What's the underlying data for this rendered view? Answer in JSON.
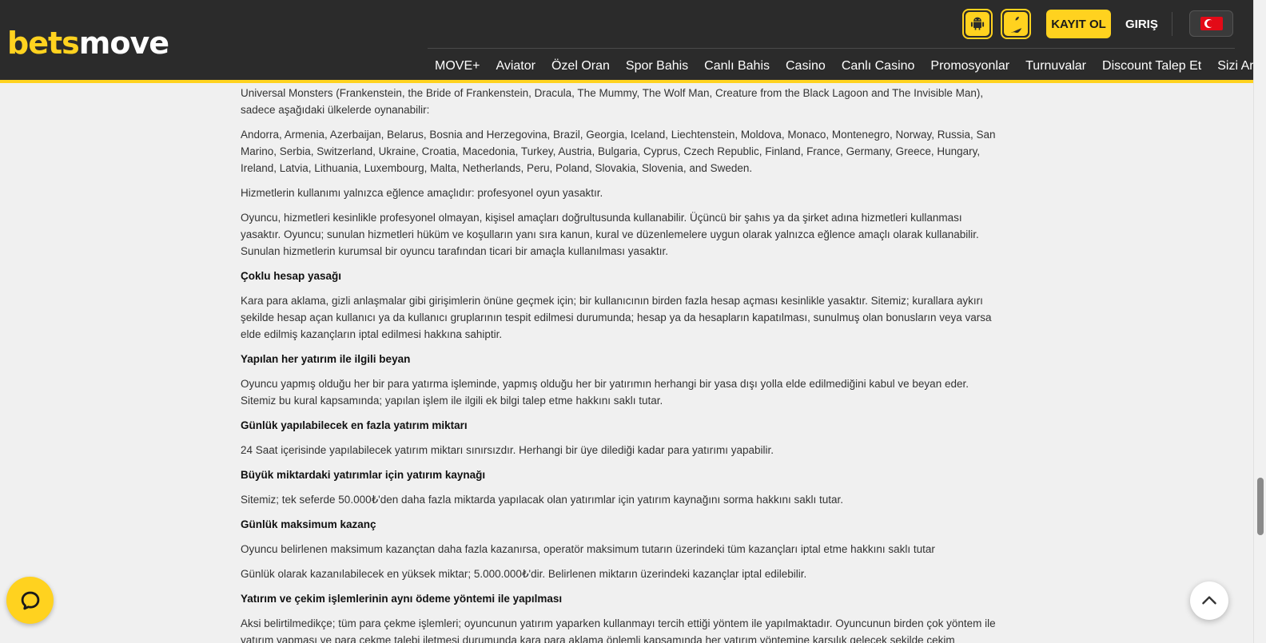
{
  "header": {
    "logo_part1": "bets",
    "logo_part2": "move",
    "register_label": "KAYIT OL",
    "login_label": "GIRIŞ",
    "nav": [
      "MOVE+",
      "Aviator",
      "Özel Oran",
      "Spor Bahis",
      "Canlı Bahis",
      "Casino",
      "Canlı Casino",
      "Promosyonlar",
      "Turnuvalar",
      "Discount Talep Et",
      "Sizi Arayalım"
    ]
  },
  "content": {
    "p1": "Universal Monsters (Frankenstein, the Bride of Frankenstein, Dracula, The Mummy, The Wolf Man, Creature from the Black Lagoon and The Invisible Man), sadece aşağıdaki ülkelerde oynanabilir:",
    "p2": "Andorra, Armenia, Azerbaijan, Belarus, Bosnia and Herzegovina, Brazil, Georgia, Iceland, Liechtenstein, Moldova, Monaco, Montenegro, Norway, Russia, San Marino, Serbia, Switzerland, Ukraine, Croatia, Macedonia, Turkey, Austria, Bulgaria, Cyprus, Czech Republic, Finland, France, Germany, Greece, Hungary, Ireland, Latvia, Lithuania, Luxembourg, Malta, Netherlands, Peru, Poland, Slovakia, Slovenia, and Sweden.",
    "p3": "Hizmetlerin kullanımı yalnızca eğlence amaçlıdır: profesyonel oyun yasaktır.",
    "p4": "Oyuncu, hizmetleri kesinlikle profesyonel olmayan, kişisel amaçları doğrultusunda kullanabilir. Üçüncü bir şahıs ya da şirket adına hizmetleri kullanması yasaktır. Oyuncu; sunulan hizmetleri hüküm ve koşulların yanı sıra kanun, kural ve düzenlemelere uygun olarak yalnızca eğlence amaçlı olarak kullanabilir. Sunulan hizmetlerin kurumsal bir oyuncu tarafından ticari bir amaçla kullanılması yasaktır.",
    "h1": "Çoklu hesap yasağı",
    "p5": "Kara para aklama, gizli anlaşmalar gibi girişimlerin önüne geçmek için; bir kullanıcının birden fazla hesap açması kesinlikle yasaktır. Sitemiz; kurallara aykırı şekilde hesap açan kullanıcı ya da kullanıcı gruplarının tespit edilmesi durumunda; hesap ya da hesapların kapatılması, sunulmuş olan bonusların veya varsa elde edilmiş kazançların iptal edilmesi hakkına sahiptir.",
    "h2": "Yapılan her yatırım ile ilgili beyan",
    "p6": "Oyuncu yapmış olduğu her bir para yatırma işleminde, yapmış olduğu her bir yatırımın herhangi bir yasa dışı yolla elde edilmediğini kabul ve beyan eder. Sitemiz bu kural kapsamında; yapılan işlem ile ilgili ek bilgi talep etme hakkını saklı tutar.",
    "h3": "Günlük yapılabilecek en fazla yatırım miktarı",
    "p7": "24 Saat içerisinde yapılabilecek yatırım miktarı sınırsızdır. Herhangi bir üye dilediği kadar para yatırımı yapabilir.",
    "h4": "Büyük miktardaki yatırımlar için yatırım kaynağı",
    "p8": "Sitemiz; tek seferde 50.000₺'den daha fazla miktarda yapılacak olan yatırımlar için yatırım kaynağını sorma hakkını saklı tutar.",
    "h5": "Günlük maksimum kazanç",
    "p9": "Oyuncu belirlenen maksimum kazançtan daha fazla kazanırsa, operatör maksimum tutarın üzerindeki tüm kazançları iptal etme hakkını saklı tutar",
    "p10": "Günlük olarak kazanılabilecek en yüksek miktar; 5.000.000₺'dir. Belirlenen miktarın üzerindeki kazançlar iptal edilebilir.",
    "h6": "Yatırım ve çekim işlemlerinin aynı ödeme yöntemi ile yapılması",
    "p11": "Aksi belirtilmedikçe; tüm para çekme işlemleri; oyuncunun yatırım yaparken kullanmayı tercih ettiği yöntem ile yapılmaktadır. Oyuncunun birden çok yöntem ile yatırım yapması ve para çekme talebi iletmesi durumunda kara para aklama önlemli kapsamında her yatırım yöntemine karşılık gelecek şekilde çekim talebinin"
  },
  "colors": {
    "accent": "#ffd21f",
    "header_bg": "#2b2b2b",
    "page_bg": "#f0f0f0"
  }
}
